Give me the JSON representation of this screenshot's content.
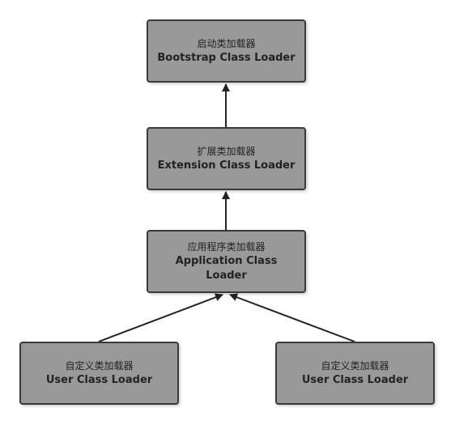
{
  "nodes": {
    "bootstrap": {
      "zh": "启动类加载器",
      "en": "Bootstrap Class Loader"
    },
    "extension": {
      "zh": "扩展类加载器",
      "en": "Extension Class Loader"
    },
    "application": {
      "zh": "应用程序类加载器",
      "en": "Application Class Loader"
    },
    "user_1": {
      "zh": "自定义类加载器",
      "en": "User Class Loader"
    },
    "user_2": {
      "zh": "自定义类加载器",
      "en": "User Class Loader"
    }
  },
  "colors": {
    "box_fill": "#999999",
    "box_border": "#3a3a3a",
    "arrow": "#222222",
    "text": "#222222"
  }
}
